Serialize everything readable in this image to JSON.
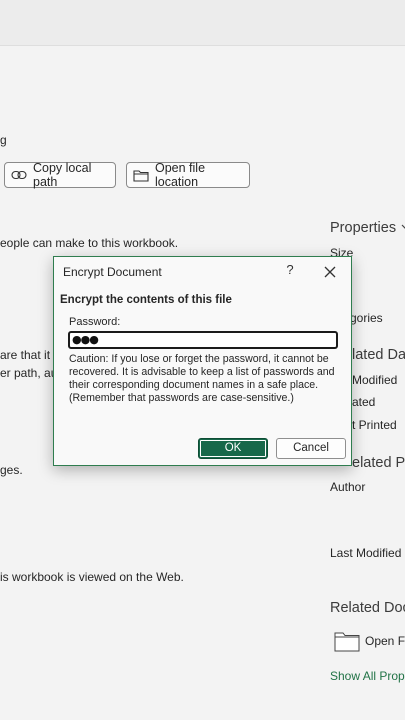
{
  "background_text": {
    "line_g": "g",
    "people_change": "eople can make to this workbook.",
    "aware_frag": "are that it c",
    "path_frag": "er path, aut",
    "ges": "ges.",
    "web": "is workbook is viewed on the Web."
  },
  "actions": {
    "copy_path": "Copy local path",
    "open_location": "Open file location"
  },
  "properties_panel": {
    "title": "Properties",
    "size": "Size",
    "categories": "gories",
    "related_dates": "lated Dat",
    "last_modified": "Modified",
    "created": "ated",
    "last_printed": "t Printed",
    "related_people": "elated Peo",
    "author": "Author",
    "last_modified_by": "Last Modified B",
    "related_docs": "Related Doc",
    "open_file": "Open Fil",
    "show_all": "Show All Prope"
  },
  "dialog": {
    "title": "Encrypt Document",
    "help": "?",
    "heading": "Encrypt the contents of this file",
    "password_label": "Password:",
    "password_value": "●●●",
    "caution": "Caution: If you lose or forget the password, it cannot be recovered. It is advisable to keep a list of passwords and their corresponding document names in a safe place.",
    "note": "(Remember that passwords are case-sensitive.)",
    "ok": "OK",
    "cancel": "Cancel"
  },
  "colors": {
    "accent": "#217346",
    "ok_button": "#17684a",
    "dialog_border": "#2f7d4f"
  }
}
